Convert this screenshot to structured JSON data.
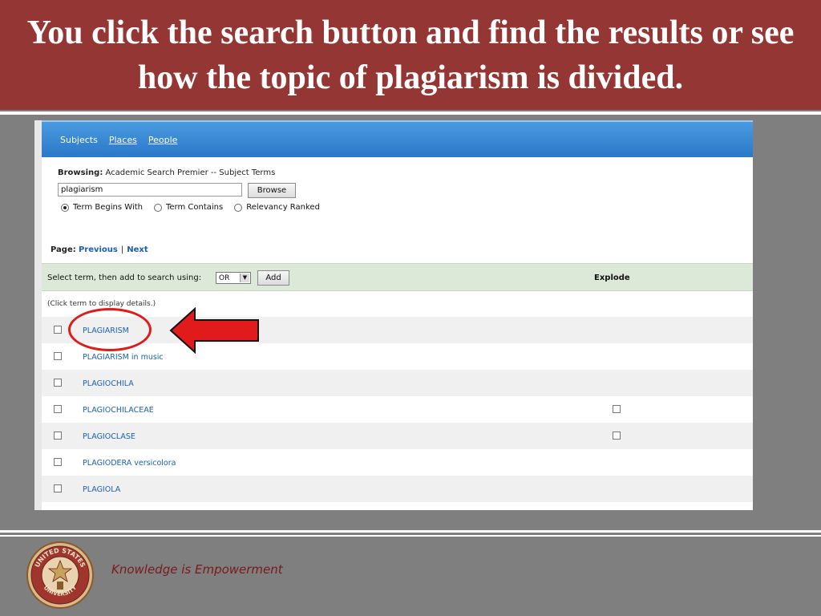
{
  "slide": {
    "title": "You click the search button and find the results or see how the topic of plagiarism is divided.",
    "tagline": "Knowledge is Empowerment",
    "seal_text": [
      "UNITED STATES",
      "UNIVERSITY"
    ]
  },
  "tabs": {
    "subjects": "Subjects",
    "places": "Places",
    "people": "People"
  },
  "browse": {
    "browsing_label": "Browsing:",
    "browsing_value": "Academic Search Premier -- Subject Terms",
    "term_value": "plagiarism",
    "browse_button": "Browse",
    "radio_options": [
      "Term Begins With",
      "Term Contains",
      "Relevancy Ranked"
    ],
    "selected_option": "Term Begins With"
  },
  "paging": {
    "label": "Page:",
    "previous": "Previous",
    "separator": "|",
    "next": "Next"
  },
  "select_bar": {
    "label": "Select term, then add to search using:",
    "operator": "OR",
    "add_button": "Add",
    "explode_header": "Explode"
  },
  "hint": "(Click term to display details.)",
  "terms": [
    {
      "label": "PLAGIARISM",
      "explode": false
    },
    {
      "label": "PLAGIARISM in music",
      "explode": false
    },
    {
      "label": "PLAGIOCHILA",
      "explode": false
    },
    {
      "label": "PLAGIOCHILACEAE",
      "explode": true
    },
    {
      "label": "PLAGIOCLASE",
      "explode": true
    },
    {
      "label": "PLAGIODERA versicolora",
      "explode": false
    },
    {
      "label": "PLAGIOLA",
      "explode": false
    }
  ],
  "colors": {
    "header_red": "#943634",
    "annotation_red": "#e11b1b",
    "link_blue": "#1a5fb4",
    "topbar_blue": "#2a78c8",
    "select_bar_green": "#dde9d8",
    "slide_gray": "#7f7f7f"
  },
  "icons": {
    "arrow": "red-left-arrow-icon",
    "circle": "red-circle-highlight",
    "seal": "university-seal-logo"
  }
}
